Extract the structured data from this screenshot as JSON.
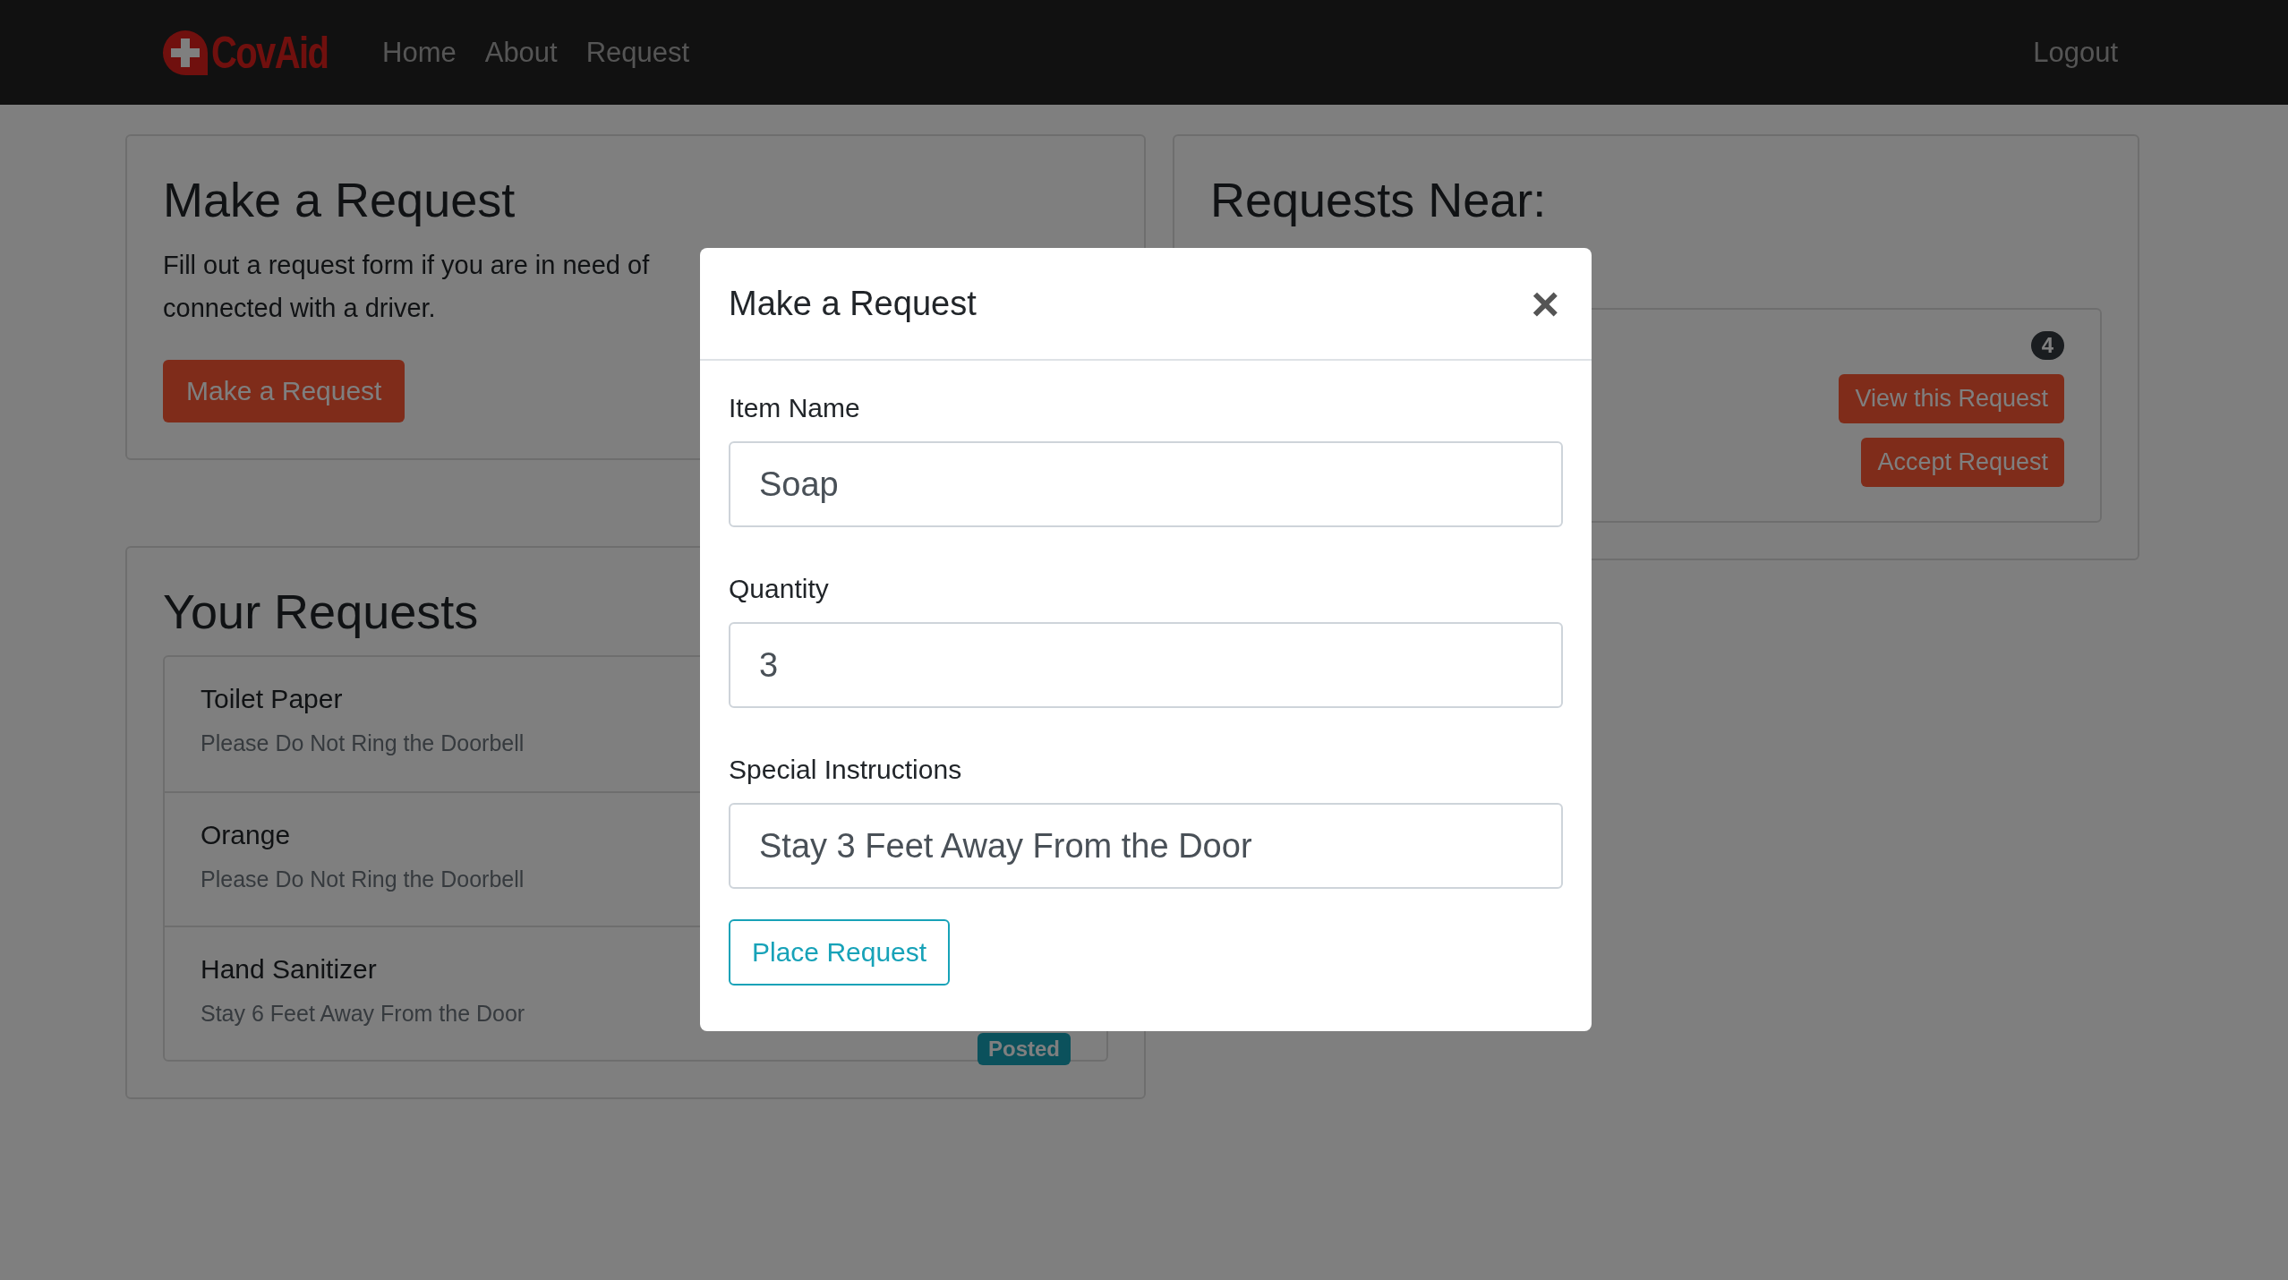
{
  "navbar": {
    "brand": "CovAid",
    "links": [
      "Home",
      "About",
      "Request"
    ],
    "logout": "Logout"
  },
  "make_request_card": {
    "title": "Make a Request",
    "text_lines": [
      "Fill out a request form if you are in need of",
      "connected with a driver."
    ],
    "button": "Make a Request"
  },
  "your_requests": {
    "title": "Your Requests",
    "items": [
      {
        "name": "Toilet Paper",
        "instructions": "Please Do Not Ring the Doorbell"
      },
      {
        "name": "Orange",
        "instructions": "Please Do Not Ring the Doorbell"
      },
      {
        "name": "Hand Sanitizer",
        "instructions": "Stay 6 Feet Away From the Door",
        "status": "Posted"
      }
    ]
  },
  "requests_near": {
    "title": "Requests Near:",
    "items": [
      {
        "badge": "4",
        "buttons": [
          "View this Request",
          "Accept Request"
        ]
      }
    ]
  },
  "modal": {
    "title": "Make a Request",
    "close": "×",
    "fields": [
      {
        "label": "Item Name",
        "value": "Soap"
      },
      {
        "label": "Quantity",
        "value": "3"
      },
      {
        "label": "Special Instructions",
        "value": "Stay 3 Feet Away From the Door"
      }
    ],
    "submit": "Place Request"
  }
}
